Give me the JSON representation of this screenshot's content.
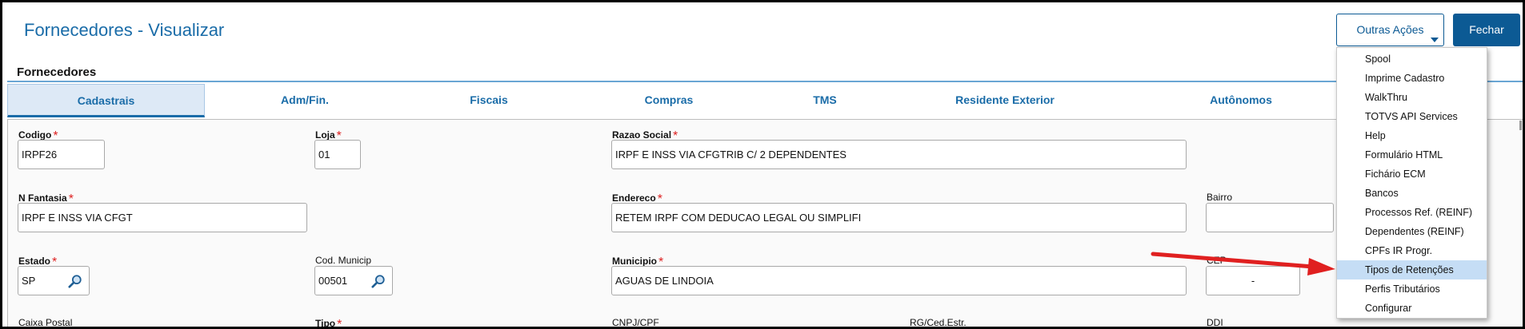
{
  "header": {
    "title": "Fornecedores - Visualizar",
    "outras_acoes_label": "Outras Ações",
    "fechar_label": "Fechar"
  },
  "section": {
    "title": "Fornecedores"
  },
  "tabs": [
    {
      "label": "Cadastrais",
      "active": true
    },
    {
      "label": "Adm/Fin.",
      "active": false
    },
    {
      "label": "Fiscais",
      "active": false
    },
    {
      "label": "Compras",
      "active": false
    },
    {
      "label": "TMS",
      "active": false
    },
    {
      "label": "Residente Exterior",
      "active": false
    },
    {
      "label": "Autônomos",
      "active": false
    }
  ],
  "form": {
    "codigo": {
      "label": "Codigo",
      "value": "IRPF26"
    },
    "loja": {
      "label": "Loja",
      "value": "01"
    },
    "razao_social": {
      "label": "Razao Social",
      "value": "IRPF E INSS VIA CFGTRIB C/ 2 DEPENDENTES"
    },
    "n_fantasia": {
      "label": "N Fantasia",
      "value": "IRPF E INSS VIA CFGT"
    },
    "endereco": {
      "label": "Endereco",
      "value": "RETEM IRPF COM DEDUCAO LEGAL OU SIMPLIFI"
    },
    "bairro": {
      "label": "Bairro",
      "value": ""
    },
    "estado": {
      "label": "Estado",
      "value": "SP"
    },
    "cod_municip": {
      "label": "Cod. Municip",
      "value": "00501"
    },
    "municipio": {
      "label": "Municipio",
      "value": "AGUAS DE LINDOIA"
    },
    "cep": {
      "label": "CEP",
      "value": "-"
    },
    "caixa_postal": {
      "label": "Caixa Postal"
    },
    "tipo": {
      "label": "Tipo"
    },
    "cnpj_cpf": {
      "label": "CNPJ/CPF"
    },
    "rg_ced_estr": {
      "label": "RG/Ced.Estr."
    },
    "ddi": {
      "label": "DDI"
    }
  },
  "required_marker": "*",
  "menu": {
    "items": [
      {
        "label": "Spool"
      },
      {
        "label": "Imprime Cadastro"
      },
      {
        "label": "WalkThru"
      },
      {
        "label": "TOTVS API Services"
      },
      {
        "label": "Help"
      },
      {
        "label": "Formulário HTML"
      },
      {
        "label": "Fichário ECM"
      },
      {
        "label": "Bancos"
      },
      {
        "label": "Processos Ref. (REINF)"
      },
      {
        "label": "Dependentes (REINF)"
      },
      {
        "label": "CPFs IR Progr."
      },
      {
        "label": "Tipos de Retenções",
        "highlighted": true
      },
      {
        "label": "Perfis Tributários"
      },
      {
        "label": "Configurar"
      }
    ]
  },
  "colors": {
    "accent": "#0c5a94",
    "title_blue": "#1a6ca8",
    "required_red": "#dd2222",
    "annotation_arrow": "#e02020",
    "menu_highlight": "#c5ddf5"
  },
  "icons": {
    "lookup": "magnifier-icon",
    "dropdown": "caret-down-icon",
    "annotation": "red-arrow-icon"
  }
}
